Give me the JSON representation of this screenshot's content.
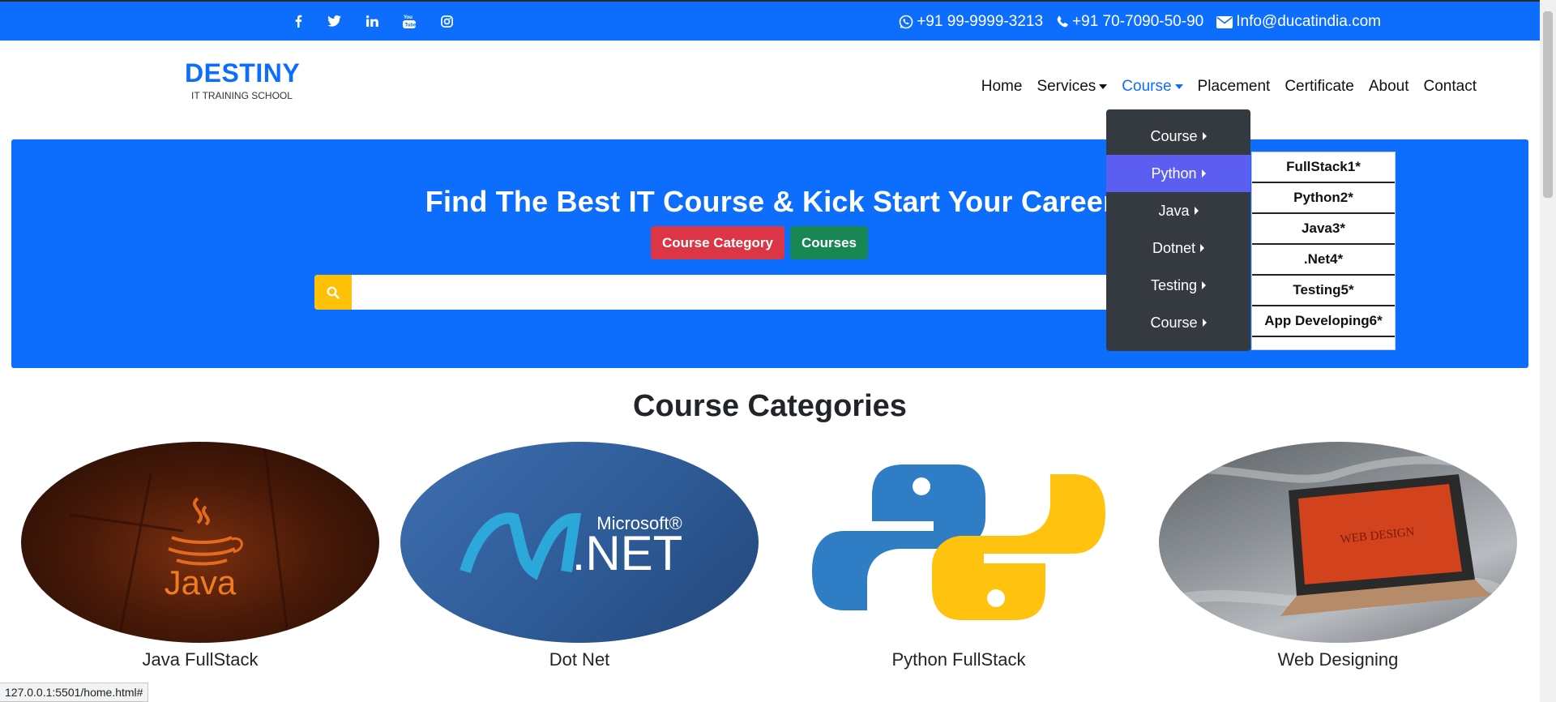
{
  "topbar": {
    "social_icons": [
      "facebook-icon",
      "twitter-icon",
      "linkedin-icon",
      "youtube-icon",
      "instagram-icon"
    ],
    "phone1": "+91 99-9999-3213",
    "phone2": "+91 70-7090-50-90",
    "email": "Info@ducatindia.com"
  },
  "brand": {
    "title": "DESTINY",
    "subtitle": "IT TRAINING SCHOOL"
  },
  "nav": {
    "items": [
      "Home",
      "Services",
      "Course",
      "Placement",
      "Certificate",
      "About",
      "Contact"
    ]
  },
  "hero": {
    "title": "Find The Best IT Course & Kick Start Your Career",
    "btn_category": "Course Category",
    "btn_courses": "Courses",
    "search_placeholder": "",
    "search_value": ""
  },
  "dropdown": {
    "items": [
      "Course",
      "Python",
      "Java",
      "Dotnet",
      "Testing",
      "Course"
    ]
  },
  "submenu": {
    "items": [
      "FullStack1*",
      "Python2*",
      "Java3*",
      ".Net4*",
      "Testing5*",
      "App Developing6*"
    ]
  },
  "categories": {
    "title": "Course Categories",
    "cards": [
      {
        "label": "Java FullStack",
        "image_text": "Java"
      },
      {
        "label": "Dot Net",
        "image_text": ".NET",
        "image_sup": "Microsoft®"
      },
      {
        "label": "Python FullStack"
      },
      {
        "label": "Web Designing",
        "image_text": "WEB DESIGN"
      }
    ]
  },
  "status_url": "127.0.0.1:5501/home.html#",
  "colors": {
    "primary": "#0d6efd",
    "danger": "#dc3545",
    "success": "#198754",
    "warning": "#ffc107",
    "dark": "#343a40",
    "highlight": "#5b5ef0"
  }
}
